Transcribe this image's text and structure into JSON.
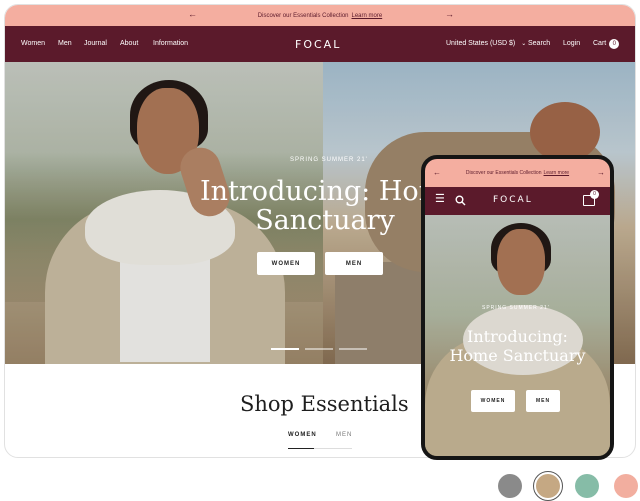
{
  "announcement": {
    "text": "Discover our Essentials Collection",
    "link": "Learn more",
    "prev_icon": "arrow-left",
    "next_icon": "arrow-right"
  },
  "nav": {
    "links": [
      "Women",
      "Men",
      "Journal",
      "About",
      "Information"
    ],
    "logo": "FOCAL",
    "currency": "United States (USD $)",
    "search": "Search",
    "login": "Login",
    "cart": "Cart",
    "cart_count": "0"
  },
  "hero": {
    "season": "SPRING SUMMER 21'",
    "title": "Introducing: Home Sanctuary",
    "title_line1": "Introducing: Home",
    "title_line2": "Sanctuary",
    "button_women": "WOMEN",
    "button_men": "MEN",
    "active_slide": 1,
    "slide_count": 3
  },
  "section": {
    "title": "Shop Essentials",
    "tabs": [
      "WOMEN",
      "MEN"
    ],
    "active_tab": "WOMEN"
  },
  "mobile": {
    "announcement_text": "Discover our Essentials Collection",
    "announcement_link": "Learn more",
    "logo": "FOCAL",
    "cart_count": "0",
    "season": "SPRING SUMMER 21'",
    "title_line1": "Introducing:",
    "title_line2": "Home Sanctuary",
    "button_women": "WOMEN",
    "button_men": "MEN"
  },
  "swatches": {
    "colors": [
      "#8a8a8a",
      "#c5a883",
      "#86bca7",
      "#f2ae9f"
    ],
    "selected_index": 1
  },
  "theme": {
    "brand": "#5b1a2b",
    "announcement_bg": "#f4aea0"
  }
}
